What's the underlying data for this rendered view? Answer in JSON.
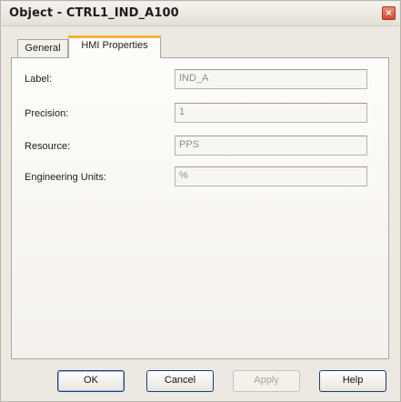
{
  "window": {
    "title": "Object - CTRL1_IND_A100",
    "close_glyph": "×"
  },
  "tabs": [
    {
      "label": "General",
      "selected": false
    },
    {
      "label": "HMI Properties",
      "selected": true
    }
  ],
  "fields": {
    "label": {
      "label": "Label:",
      "value": "IND_A"
    },
    "precision": {
      "label": "Precision:",
      "value": "1"
    },
    "resource": {
      "label": "Resource:",
      "value": "PPS"
    },
    "engineering_units": {
      "label": "Engineering Units:",
      "value": "%"
    }
  },
  "buttons": {
    "ok": "OK",
    "cancel": "Cancel",
    "apply": "Apply",
    "help": "Help"
  },
  "colors": {
    "close_button": "#d44a2f",
    "selected_tab_accent": "#f3b23c",
    "default_button_border": "#1f3a7a"
  }
}
